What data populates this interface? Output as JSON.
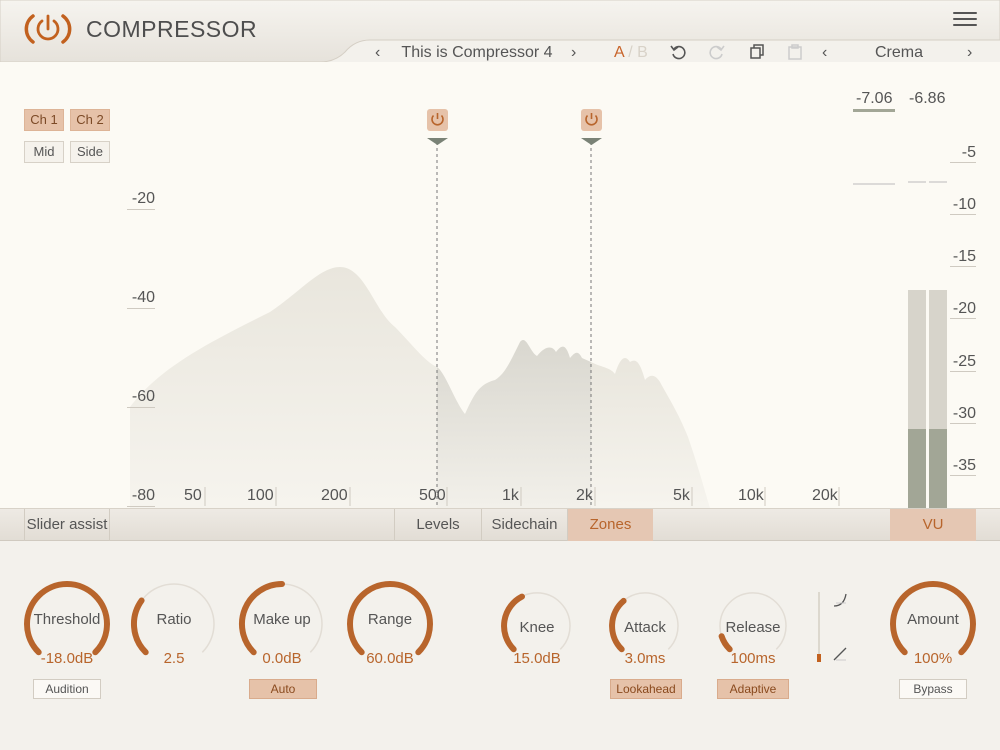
{
  "app": {
    "title": "COMPRESSOR",
    "accent": "#b8652c"
  },
  "toolbar": {
    "prev_preset": "‹",
    "preset_name": "This is Compressor 4",
    "next_preset": "›",
    "ab_a": "A",
    "ab_sep": "/",
    "ab_b": "B",
    "prev_theme": "‹",
    "theme_name": "Crema",
    "next_theme": "›"
  },
  "channels": {
    "ch1": "Ch 1",
    "ch2": "Ch 2",
    "mid": "Mid",
    "side": "Side"
  },
  "graph": {
    "y_labels": [
      "-20",
      "-40",
      "-60",
      "-80"
    ],
    "x_labels": [
      "50",
      "100",
      "200",
      "500",
      "1k",
      "2k",
      "5k",
      "10k",
      "20k"
    ],
    "zone_split_1": "500",
    "zone_split_2": "2k"
  },
  "meters": {
    "left_value": "-7.06",
    "right_value": "-6.86",
    "scale": [
      "-5",
      "-10",
      "-15",
      "-20",
      "-25",
      "-30",
      "-35"
    ]
  },
  "tabs": {
    "slider_assist": "Slider assist",
    "levels": "Levels",
    "sidechain": "Sidechain",
    "zones": "Zones",
    "vu": "VU"
  },
  "knobs": {
    "threshold": {
      "label": "Threshold",
      "value": "-18.0dB",
      "fill": 1.0
    },
    "ratio": {
      "label": "Ratio",
      "value": "2.5",
      "fill": 0.3
    },
    "makeup": {
      "label": "Make up",
      "value": "0.0dB",
      "fill": 0.5
    },
    "range": {
      "label": "Range",
      "value": "60.0dB",
      "fill": 1.0
    },
    "knee": {
      "label": "Knee",
      "value": "15.0dB",
      "fill": 0.4
    },
    "attack": {
      "label": "Attack",
      "value": "3.0ms",
      "fill": 0.35
    },
    "release": {
      "label": "Release",
      "value": "100ms",
      "fill": 0.1
    },
    "amount": {
      "label": "Amount",
      "value": "100%",
      "fill": 1.0
    }
  },
  "buttons": {
    "audition": "Audition",
    "auto": "Auto",
    "lookahead": "Lookahead",
    "adaptive": "Adaptive",
    "bypass": "Bypass"
  }
}
